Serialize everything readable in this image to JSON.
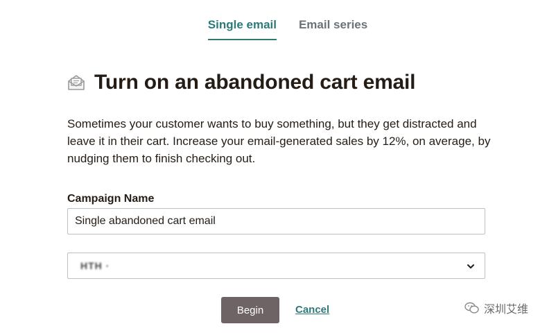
{
  "tabs": [
    {
      "label": "Single email",
      "active": true
    },
    {
      "label": "Email series",
      "active": false
    }
  ],
  "heading": {
    "icon": "envelope-open-icon",
    "title": "Turn on an abandoned cart email"
  },
  "description": "Sometimes your customer wants to buy something, but they get distracted and leave it in their cart. Increase your email-generated sales by 12%, on average, by nudging them to finish checking out.",
  "campaign_name": {
    "label": "Campaign Name",
    "value": "Single abandoned cart email"
  },
  "select": {
    "value": "HTH ·",
    "icon": "chevron-down-icon"
  },
  "actions": {
    "begin_label": "Begin",
    "cancel_label": "Cancel"
  },
  "watermark": {
    "text": "深圳艾维",
    "icon": "wechat-icon"
  },
  "colors": {
    "accent": "#2c7a78",
    "button_bg": "#6e6465",
    "text": "#241c15",
    "muted": "#6b7379"
  }
}
